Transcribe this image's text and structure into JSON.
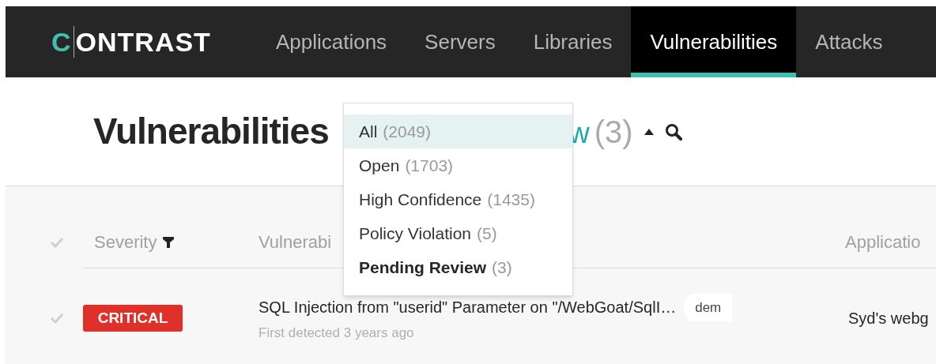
{
  "nav": {
    "logo": "CONTRAST",
    "items": [
      {
        "label": "Applications",
        "selected": false
      },
      {
        "label": "Servers",
        "selected": false
      },
      {
        "label": "Libraries",
        "selected": false
      },
      {
        "label": "Vulnerabilities",
        "selected": true
      },
      {
        "label": "Attacks",
        "selected": false
      }
    ]
  },
  "header": {
    "title": "Vulnerabilities",
    "filter_label": "w",
    "filter_count": "(3)"
  },
  "filter_menu": [
    {
      "label": "All",
      "count": "(2049)",
      "highlighted": true,
      "selected": false
    },
    {
      "label": "Open",
      "count": "(1703)",
      "highlighted": false,
      "selected": false
    },
    {
      "label": "High Confidence",
      "count": "(1435)",
      "highlighted": false,
      "selected": false
    },
    {
      "label": "Policy Violation",
      "count": "(5)",
      "highlighted": false,
      "selected": false
    },
    {
      "label": "Pending Review",
      "count": "(3)",
      "highlighted": false,
      "selected": true
    }
  ],
  "table": {
    "columns": [
      "Severity",
      "Vulnerabi",
      "Applicatio"
    ],
    "rows": [
      {
        "severity": "CRITICAL",
        "color": "#e0302a",
        "title": "SQL Injection from \"userid\" Parameter on \"/WebGoat/SqlI…",
        "subtitle": "First detected 3 years ago",
        "tag": "dem",
        "application": "Syd's webg"
      }
    ]
  }
}
